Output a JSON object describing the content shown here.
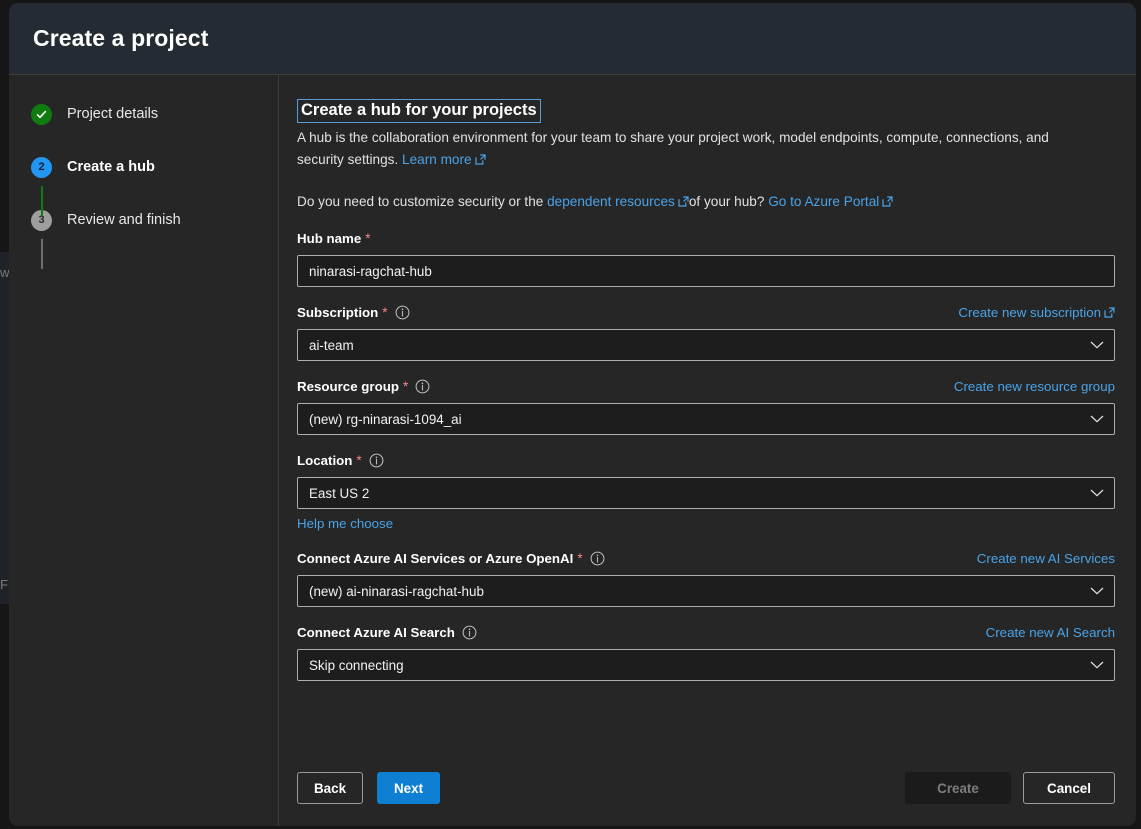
{
  "backdrop": {
    "ghost_left_top": "w",
    "ghost_left_bottom": "F"
  },
  "dialog": {
    "title": "Create a project"
  },
  "stepper": {
    "steps": [
      {
        "label": "Project details",
        "state": "done",
        "marker": "check-icon"
      },
      {
        "label": "Create a hub",
        "state": "current",
        "marker": "2"
      },
      {
        "label": "Review and finish",
        "state": "todo",
        "marker": "3"
      }
    ]
  },
  "main": {
    "panel_title": "Create a hub for your projects",
    "description": {
      "text": "A hub is the collaboration environment for your team to share your project work, model endpoints, compute, connections, and security settings.",
      "link_label": "Learn more"
    },
    "security_note": {
      "prefix": "Do you need to customize security or the",
      "link1_label": "dependent resources",
      "middle": "of your hub?",
      "link2_label": "Go to Azure Portal"
    },
    "fields": [
      {
        "label": "Hub name",
        "required": true,
        "has_info": false,
        "action": null,
        "control": "textbox",
        "value": "ninarasi-ragchat-hub",
        "sub_link": null
      },
      {
        "label": "Subscription",
        "required": true,
        "has_info": true,
        "action": {
          "label": "Create new subscription",
          "external": true
        },
        "control": "dropdown",
        "value": "ai-team",
        "sub_link": null
      },
      {
        "label": "Resource group",
        "required": true,
        "has_info": true,
        "action": {
          "label": "Create new resource group",
          "external": false
        },
        "control": "dropdown",
        "value": "(new) rg-ninarasi-1094_ai",
        "sub_link": null
      },
      {
        "label": "Location",
        "required": true,
        "has_info": true,
        "action": null,
        "control": "dropdown",
        "value": "East US 2",
        "sub_link": "Help me choose"
      },
      {
        "label": "Connect Azure AI Services or Azure OpenAI",
        "required": true,
        "has_info": true,
        "action": {
          "label": "Create new AI Services",
          "external": false
        },
        "control": "dropdown",
        "value": "(new) ai-ninarasi-ragchat-hub",
        "sub_link": null
      },
      {
        "label": "Connect Azure AI Search",
        "required": false,
        "has_info": true,
        "action": {
          "label": "Create new AI Search",
          "external": false
        },
        "control": "dropdown",
        "value": "Skip connecting",
        "sub_link": null
      }
    ]
  },
  "footer": {
    "back_label": "Back",
    "next_label": "Next",
    "create_label": "Create",
    "cancel_label": "Cancel"
  },
  "colors": {
    "accent_blue": "#0f7fd4",
    "link_blue": "#4aa3e8",
    "step_done_green": "#107c10",
    "step_current_blue": "#2196f3",
    "step_todo_gray": "#9e9e9e",
    "required_red": "#ef8a8a",
    "dialog_bg": "#262626",
    "header_bg": "#242b33"
  }
}
